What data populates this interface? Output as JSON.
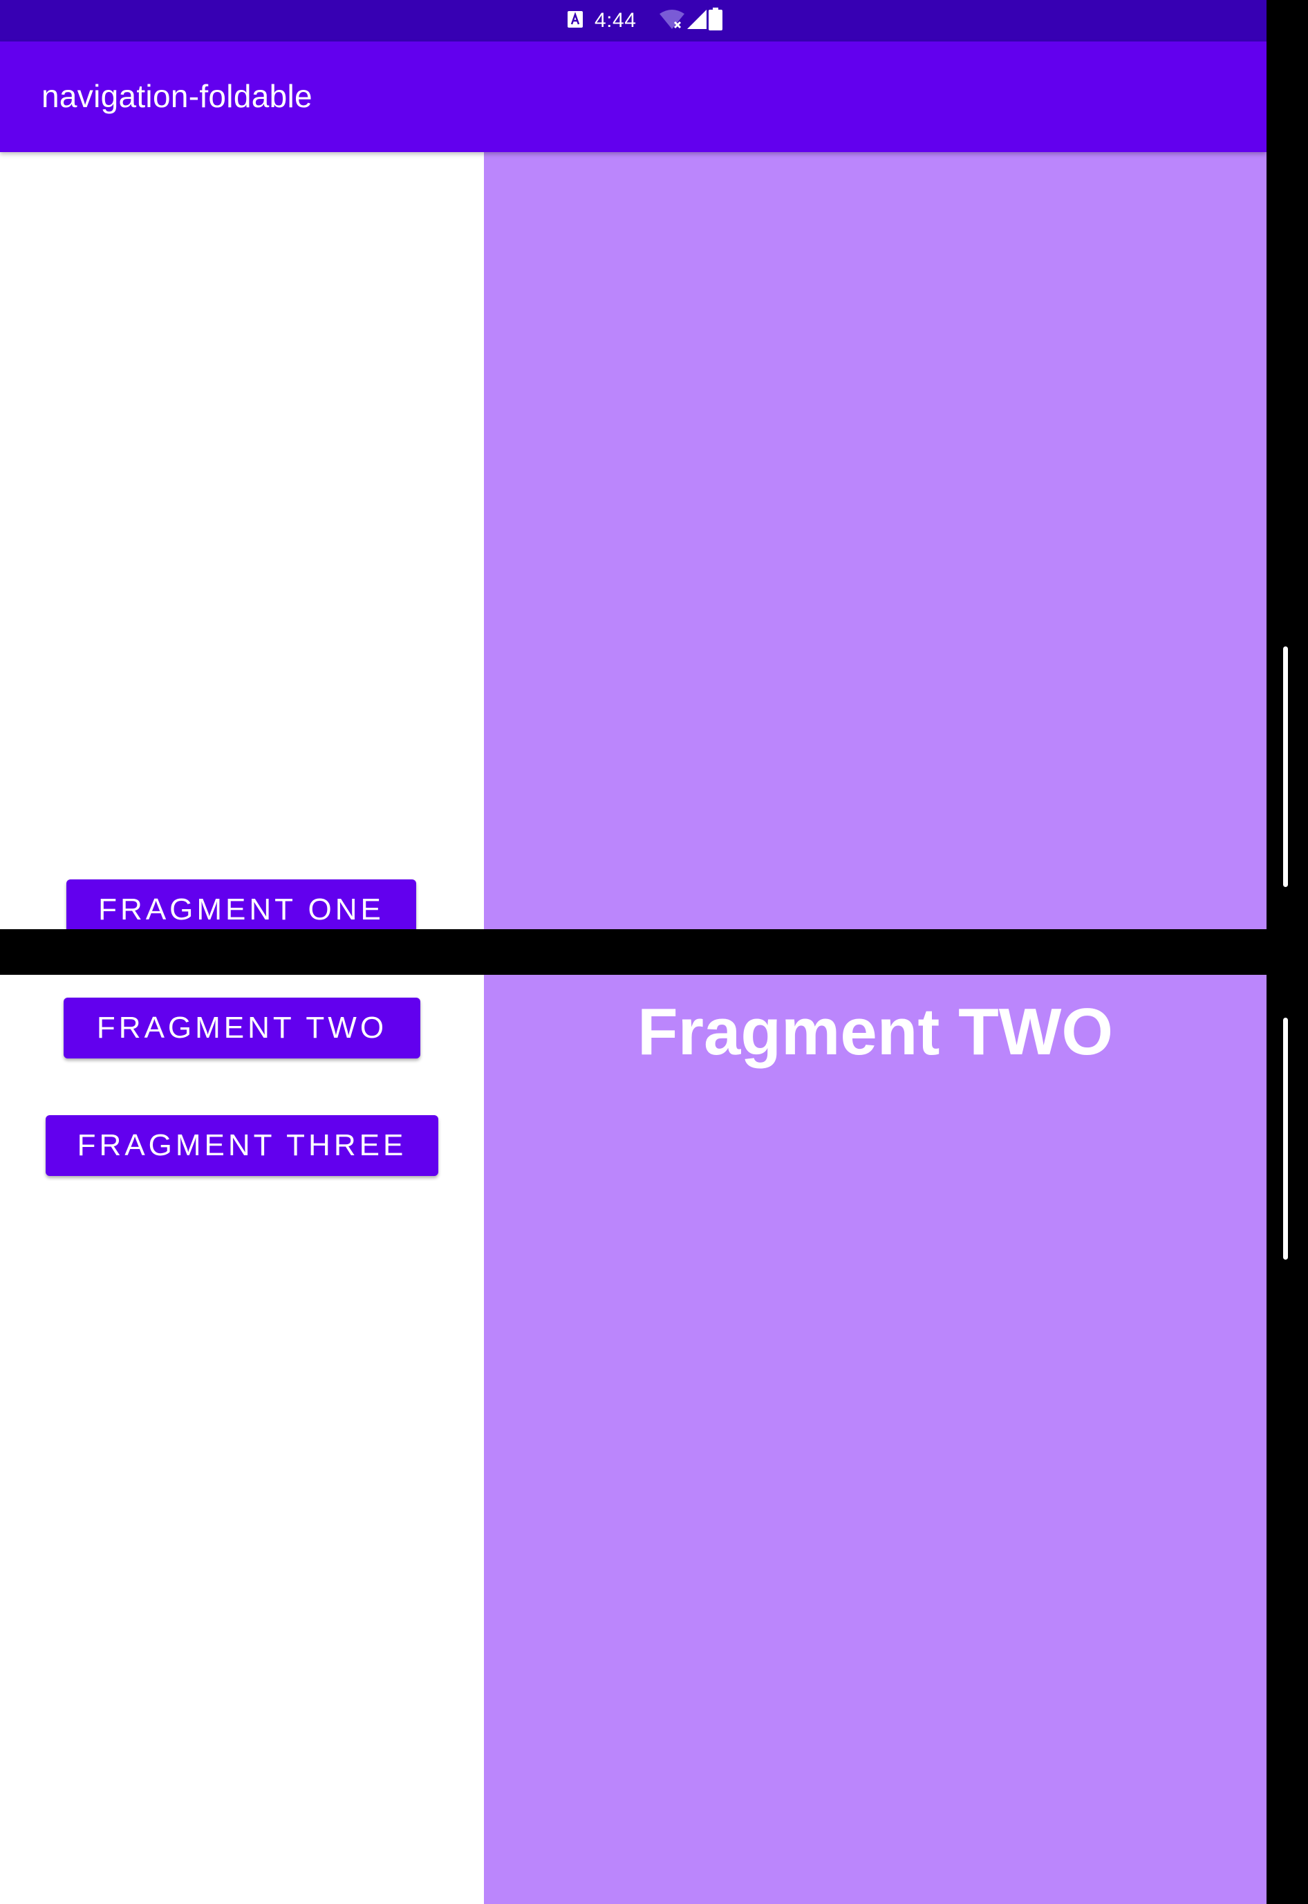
{
  "status_bar": {
    "time": "4:44",
    "icons": [
      "a-badge-icon",
      "wifi-off-icon",
      "cell-signal-icon",
      "battery-icon"
    ]
  },
  "app_bar": {
    "title": "navigation-foldable"
  },
  "nav_buttons": {
    "fragment_one": "FRAGMENT ONE",
    "fragment_two": "FRAGMENT TWO",
    "fragment_three": "FRAGMENT THREE"
  },
  "detail_pane": {
    "title": "Fragment TWO"
  },
  "colors": {
    "status_bar": "#3700B3",
    "app_bar": "#6200EE",
    "button": "#6200EE",
    "detail_background": "#BB86FC",
    "list_background": "#FFFFFF",
    "hinge": "#000000"
  }
}
